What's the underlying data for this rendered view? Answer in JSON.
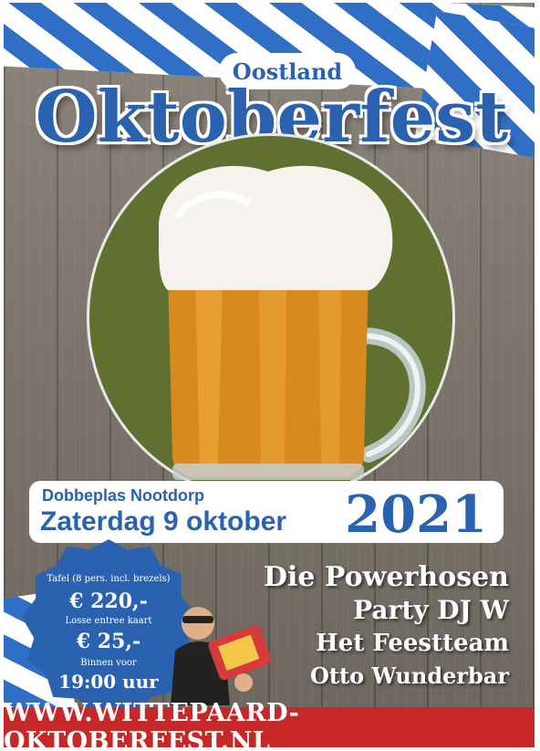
{
  "header": {
    "subtitle": "Oostland",
    "title": "Oktoberfest"
  },
  "event": {
    "location": "Dobbeplas Nootdorp",
    "date": "Zaterdag 9 oktober",
    "year": "2021"
  },
  "pricing": {
    "table_label": "Tafel (8 pers. incl. brezels)",
    "table_price": "€ 220,-",
    "entry_label": "Losse entree kaart",
    "entry_price": "€ 25,-",
    "arrive_label": "Binnen voor",
    "arrive_time": "19:00 uur"
  },
  "acts": [
    "Die Powerhosen",
    "Party DJ W",
    "Het Feestteam",
    "Otto Wunderbar"
  ],
  "footer": {
    "url": "WWW.WITTEPAARD-OKTOBERFEST.NL"
  },
  "colors": {
    "brand_blue": "#2a62b0",
    "footer_red": "#c62828",
    "circle_green": "#5f7030"
  }
}
